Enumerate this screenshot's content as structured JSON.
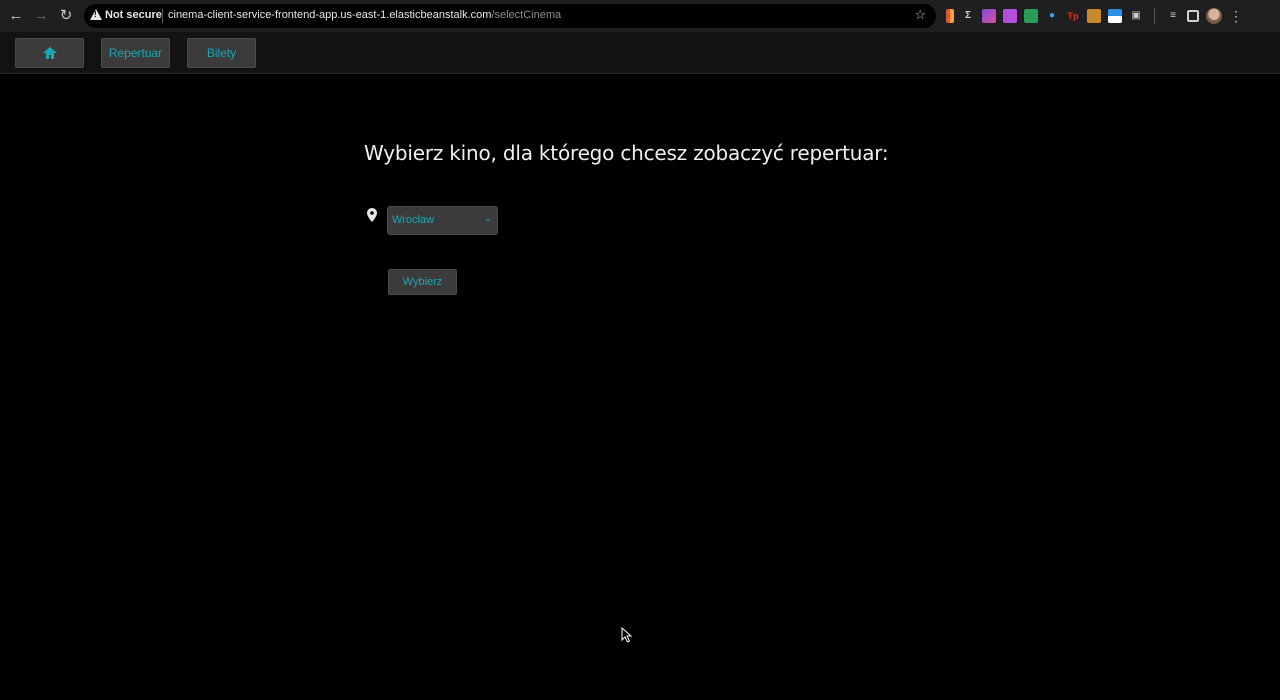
{
  "browser": {
    "security_label": "Not secure",
    "url_host": "cinema-client-service-frontend-app.us-east-1.elasticbeanstalk.com",
    "url_path": "/selectCinema",
    "icons": [
      "back-icon",
      "forward-icon",
      "reload-icon",
      "warning-icon",
      "star-icon",
      "extensions-icon",
      "reading-list-icon",
      "side-panel-icon",
      "profile-avatar",
      "menu-icon"
    ]
  },
  "site_nav": {
    "home_icon": "home-icon",
    "items": [
      {
        "label": "Repertuar"
      },
      {
        "label": "Bilety"
      }
    ]
  },
  "main": {
    "title": "Wybierz kino, dla którego chcesz zobaczyć repertuar:",
    "location_icon": "map-pin-icon",
    "cinema_select": {
      "selected": "Wrocław"
    },
    "submit_label": "Wybierz"
  },
  "colors": {
    "background": "#000000",
    "accent": "#1aa6b3",
    "button_bg": "#3b3b3b",
    "title_text": "#f0f0f0"
  }
}
